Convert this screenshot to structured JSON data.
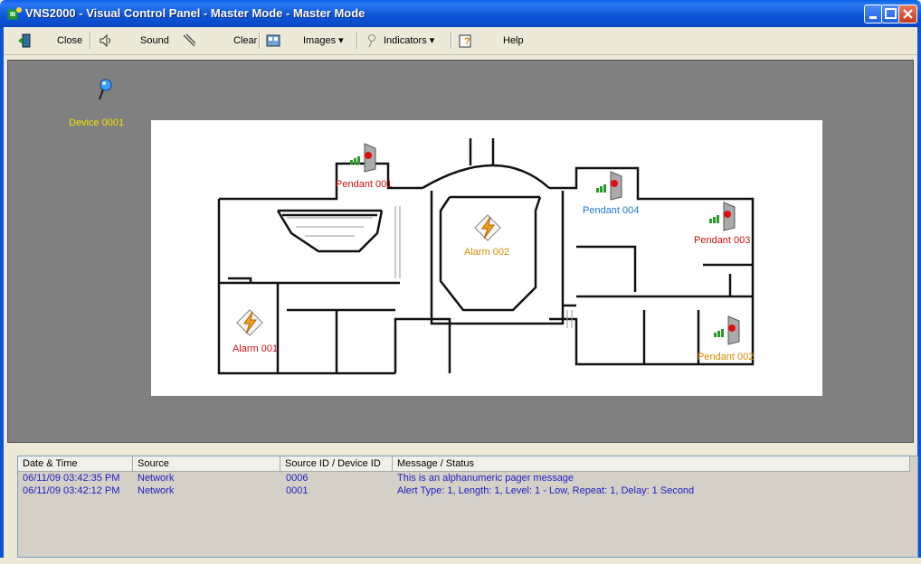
{
  "window": {
    "title": "VNS2000 - Visual Control Panel - Master Mode - Master Mode"
  },
  "toolbar": {
    "close": "Close",
    "sound": "Sound",
    "clear": "Clear",
    "images": "Images",
    "indicators": "Indicators",
    "help": "Help"
  },
  "map": {
    "device": "Device 0001",
    "pendant_001": "Pendant 001",
    "pendant_002": "Pendant 002",
    "pendant_003": "Pendant 003",
    "pendant_004": "Pendant 004",
    "alarm_001": "Alarm 001",
    "alarm_002": "Alarm 002"
  },
  "log": {
    "columns": [
      "Date & Time",
      "Source",
      "Source ID / Device ID",
      "Message / Status"
    ],
    "rows": [
      {
        "datetime": "06/11/09 03:42:35 PM",
        "source": "Network",
        "id": "0006",
        "message": "This is an alphanumeric pager message"
      },
      {
        "datetime": "06/11/09 03:42:12 PM",
        "source": "Network",
        "id": "0001",
        "message": "Alert Type: 1, Length: 1, Level: 1 - Low, Repeat: 1, Delay: 1 Second"
      }
    ]
  },
  "colors": {
    "pendant_red": "#cc1111",
    "pendant_blue": "#1a7ad0",
    "pendant_orange": "#d68a00",
    "device_yellow": "#f0e000",
    "log_text": "#2020c0"
  }
}
